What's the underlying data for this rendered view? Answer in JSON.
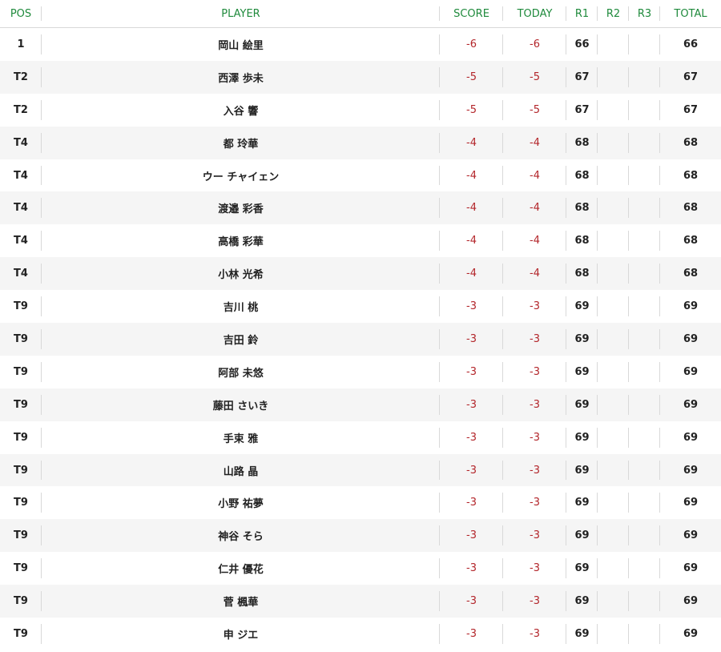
{
  "header": {
    "pos": "POS",
    "player": "PLAYER",
    "score": "SCORE",
    "today": "TODAY",
    "r1": "R1",
    "r2": "R2",
    "r3": "R3",
    "total": "TOTAL"
  },
  "colors": {
    "header_text": "#1f8a3c",
    "under_par": "#b3262b",
    "stripe": "#f5f5f5"
  },
  "rows": [
    {
      "pos": "1",
      "player": "岡山 絵里",
      "score": "-6",
      "today": "-6",
      "r1": "66",
      "r2": "",
      "r3": "",
      "total": "66"
    },
    {
      "pos": "T2",
      "player": "西澤 歩未",
      "score": "-5",
      "today": "-5",
      "r1": "67",
      "r2": "",
      "r3": "",
      "total": "67"
    },
    {
      "pos": "T2",
      "player": "入谷 響",
      "score": "-5",
      "today": "-5",
      "r1": "67",
      "r2": "",
      "r3": "",
      "total": "67"
    },
    {
      "pos": "T4",
      "player": "都 玲華",
      "score": "-4",
      "today": "-4",
      "r1": "68",
      "r2": "",
      "r3": "",
      "total": "68"
    },
    {
      "pos": "T4",
      "player": "ウー チャイェン",
      "score": "-4",
      "today": "-4",
      "r1": "68",
      "r2": "",
      "r3": "",
      "total": "68"
    },
    {
      "pos": "T4",
      "player": "渡邉 彩香",
      "score": "-4",
      "today": "-4",
      "r1": "68",
      "r2": "",
      "r3": "",
      "total": "68"
    },
    {
      "pos": "T4",
      "player": "高橋 彩華",
      "score": "-4",
      "today": "-4",
      "r1": "68",
      "r2": "",
      "r3": "",
      "total": "68"
    },
    {
      "pos": "T4",
      "player": "小林 光希",
      "score": "-4",
      "today": "-4",
      "r1": "68",
      "r2": "",
      "r3": "",
      "total": "68"
    },
    {
      "pos": "T9",
      "player": "吉川 桃",
      "score": "-3",
      "today": "-3",
      "r1": "69",
      "r2": "",
      "r3": "",
      "total": "69"
    },
    {
      "pos": "T9",
      "player": "吉田 鈴",
      "score": "-3",
      "today": "-3",
      "r1": "69",
      "r2": "",
      "r3": "",
      "total": "69"
    },
    {
      "pos": "T9",
      "player": "阿部 未悠",
      "score": "-3",
      "today": "-3",
      "r1": "69",
      "r2": "",
      "r3": "",
      "total": "69"
    },
    {
      "pos": "T9",
      "player": "藤田 さいき",
      "score": "-3",
      "today": "-3",
      "r1": "69",
      "r2": "",
      "r3": "",
      "total": "69"
    },
    {
      "pos": "T9",
      "player": "手束 雅",
      "score": "-3",
      "today": "-3",
      "r1": "69",
      "r2": "",
      "r3": "",
      "total": "69"
    },
    {
      "pos": "T9",
      "player": "山路 晶",
      "score": "-3",
      "today": "-3",
      "r1": "69",
      "r2": "",
      "r3": "",
      "total": "69"
    },
    {
      "pos": "T9",
      "player": "小野 祐夢",
      "score": "-3",
      "today": "-3",
      "r1": "69",
      "r2": "",
      "r3": "",
      "total": "69"
    },
    {
      "pos": "T9",
      "player": "神谷 そら",
      "score": "-3",
      "today": "-3",
      "r1": "69",
      "r2": "",
      "r3": "",
      "total": "69"
    },
    {
      "pos": "T9",
      "player": "仁井 優花",
      "score": "-3",
      "today": "-3",
      "r1": "69",
      "r2": "",
      "r3": "",
      "total": "69"
    },
    {
      "pos": "T9",
      "player": "菅 楓華",
      "score": "-3",
      "today": "-3",
      "r1": "69",
      "r2": "",
      "r3": "",
      "total": "69"
    },
    {
      "pos": "T9",
      "player": "申 ジエ",
      "score": "-3",
      "today": "-3",
      "r1": "69",
      "r2": "",
      "r3": "",
      "total": "69"
    }
  ]
}
